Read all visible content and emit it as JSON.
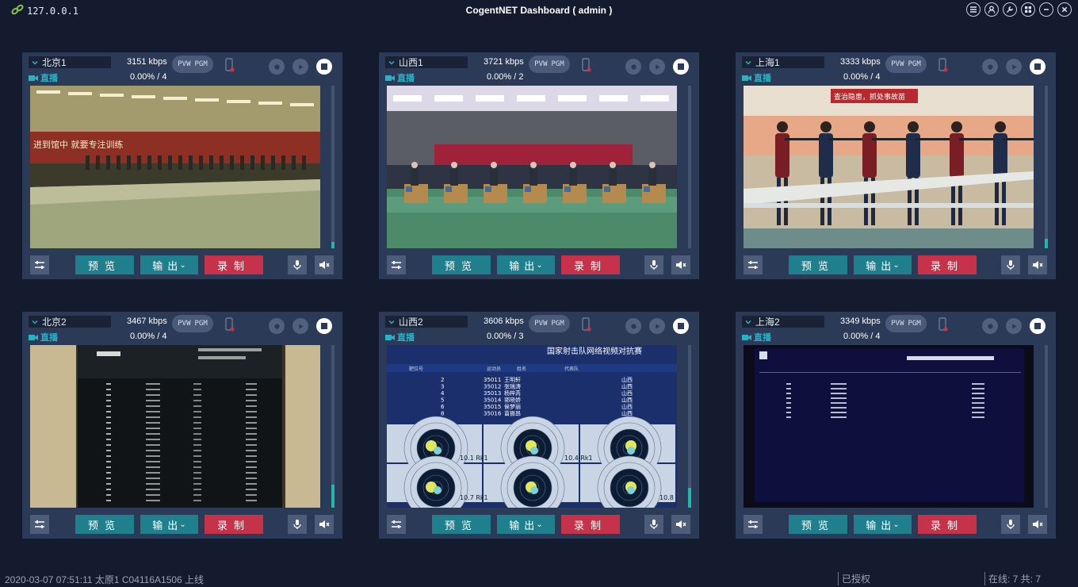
{
  "titlebar": {
    "address": "127.0.0.1",
    "title": "CogentNET Dashboard ( admin )",
    "buttons": [
      "menu-icon",
      "user-icon",
      "wrench-icon",
      "grid-icon",
      "minimize-icon",
      "close-icon"
    ]
  },
  "labels": {
    "live": "直播",
    "pvw": "PVW",
    "pgm": "PGM",
    "preview": "预览",
    "output": "输出",
    "record": "录制",
    "output_caret": "⌄"
  },
  "panels": [
    {
      "name": "北京1",
      "kbps": "3151 kbps",
      "progress": "0.00% / 4",
      "audio_level": 0.04,
      "scene": "range-hall"
    },
    {
      "name": "山西1",
      "kbps": "3721 kbps",
      "progress": "0.00% / 2",
      "audio_level": 0.0,
      "scene": "arena"
    },
    {
      "name": "上海1",
      "kbps": "3333 kbps",
      "progress": "0.00% / 4",
      "audio_level": 0.06,
      "scene": "shooters"
    },
    {
      "name": "北京2",
      "kbps": "3467 kbps",
      "progress": "0.00% / 4",
      "audio_level": 0.14,
      "scene": "scoreboard-photo"
    },
    {
      "name": "山西2",
      "kbps": "3606 kbps",
      "progress": "0.00% / 3",
      "audio_level": 0.12,
      "scene": "targets"
    },
    {
      "name": "上海2",
      "kbps": "3349 kbps",
      "progress": "0.00% / 4",
      "audio_level": 0.0,
      "scene": "scoreboard-dark"
    }
  ],
  "scenes": {
    "arena_banner": "国家射击队网络视频对抗赛",
    "table_headers": [
      "靶位号",
      "运动员",
      "姓名",
      "代表队"
    ],
    "table_rows": [
      [
        "2",
        "35011",
        "王明轩",
        "山西"
      ],
      [
        "3",
        "35012",
        "张瑞涛",
        "山西"
      ],
      [
        "4",
        "35013",
        "杨梓芮",
        "山西"
      ],
      [
        "5",
        "35014",
        "郭晓娇",
        "山西"
      ],
      [
        "6",
        "35015",
        "侯梦丽",
        "山西"
      ],
      [
        "8",
        "35016",
        "苗振昂",
        "山西"
      ]
    ],
    "target_readouts": [
      "10.1 Rk1",
      "10.4 Rk1",
      "10.7 Rk1",
      "10.8"
    ],
    "banner_red": "进到馆中 就要专注训练",
    "banner_sh": "查治隐患，抓处事故苗"
  },
  "statusbar": {
    "log": "2020-03-07 07:51:11 太原1 C04116A1506 上线",
    "auth": "已授权",
    "online": "在线: 7 共: 7"
  },
  "colors": {
    "accent": "#1f7f8d",
    "record": "#c53249",
    "live": "#26b3c6",
    "vu": "#22b7aa"
  }
}
